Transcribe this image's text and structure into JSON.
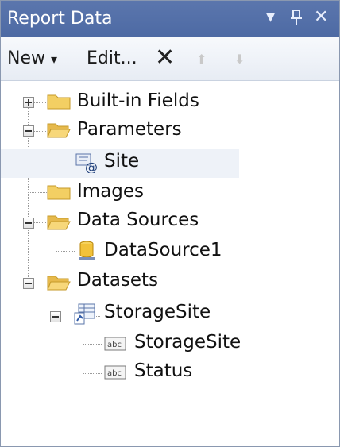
{
  "window": {
    "title": "Report Data",
    "dropdown_glyph": "▾",
    "pin_glyph": "ꟸ",
    "close_glyph": "✕"
  },
  "toolbar": {
    "new_label": "New",
    "new_arrow": "▾",
    "edit_label": "Edit...",
    "delete_glyph": "✕",
    "up_glyph": "⬆",
    "down_glyph": "⬇"
  },
  "tree": {
    "builtin_fields": "Built-in Fields",
    "parameters": "Parameters",
    "site": "Site",
    "images": "Images",
    "data_sources": "Data Sources",
    "datasource1": "DataSource1",
    "datasets": "Datasets",
    "storagesite_dataset": "StorageSite",
    "field_storagesite": "StorageSite",
    "field_status": "Status"
  },
  "colors": {
    "titlebar": "#4d6aa4",
    "folder": "#f3cf63",
    "tree_lines": "#9a9a9a"
  }
}
